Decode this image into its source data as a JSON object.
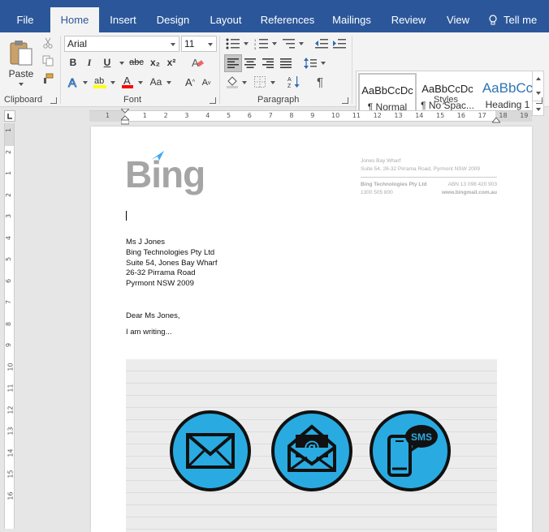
{
  "tabs": [
    {
      "label": "File",
      "active": false
    },
    {
      "label": "Home",
      "active": true
    },
    {
      "label": "Insert",
      "active": false
    },
    {
      "label": "Design",
      "active": false
    },
    {
      "label": "Layout",
      "active": false
    },
    {
      "label": "References",
      "active": false
    },
    {
      "label": "Mailings",
      "active": false
    },
    {
      "label": "Review",
      "active": false
    },
    {
      "label": "View",
      "active": false
    },
    {
      "label": "Tell me",
      "active": false
    }
  ],
  "ribbon": {
    "clipboard": {
      "paste_label": "Paste",
      "group_label": "Clipboard"
    },
    "font": {
      "group_label": "Font",
      "font_name": "Arial",
      "font_size": "11",
      "bold": "B",
      "italic": "I",
      "underline": "U",
      "strike": "abc",
      "subscript": "x₂",
      "superscript": "x²",
      "change_case": "Aa",
      "grow": "A",
      "shrink": "A",
      "highlight_color": "#ffff00",
      "font_color": "#ff0000"
    },
    "paragraph": {
      "group_label": "Paragraph",
      "pilcrow": "¶"
    },
    "styles": {
      "group_label": "Styles",
      "items": [
        {
          "preview": "AaBbCcDc",
          "name": "¶ Normal",
          "selected": true
        },
        {
          "preview": "AaBbCcDc",
          "name": "¶ No Spac...",
          "selected": false
        },
        {
          "preview": "AaBbCc",
          "name": "Heading 1",
          "selected": false
        }
      ]
    }
  },
  "ruler": {
    "h_numbers": [
      "1",
      "1",
      "2",
      "3",
      "4",
      "5",
      "6",
      "7",
      "8",
      "9",
      "10",
      "11",
      "12",
      "13",
      "14",
      "15",
      "16",
      "17",
      "18",
      "19"
    ],
    "v_numbers": [
      "1",
      "2",
      "1",
      "2",
      "3",
      "4",
      "5",
      "6",
      "7",
      "8",
      "9",
      "10",
      "11",
      "12",
      "13",
      "14",
      "15",
      "16"
    ]
  },
  "document": {
    "logo": "Bing",
    "letterhead": {
      "line1": "Jones Bay Wharf",
      "line2": "Suite 54, 26-32 Pirrama Road, Pyrmont NSW 2009",
      "company": "Bing Technologies Pty Ltd",
      "abn": "ABN 13 098 420 903",
      "phone": "1300 505 800",
      "website": "www.bingmail.com.au"
    },
    "address": [
      "Ms J Jones",
      "Bing Technologies Pty Ltd",
      "Suite 54, Jones Bay Wharf",
      "26-32 Pirrama Road",
      "Pyrmont NSW 2009"
    ],
    "salutation": "Dear Ms Jones,",
    "body": "I am writing...",
    "image_icons": [
      {
        "icon": "envelope-icon"
      },
      {
        "icon": "email-at-icon",
        "symbol": "@"
      },
      {
        "icon": "sms-phone-icon",
        "badge": "SMS"
      }
    ]
  },
  "colors": {
    "accent": "#2b579a",
    "icon_fill": "#29abe2",
    "logo_blue": "#3fa9f5"
  }
}
